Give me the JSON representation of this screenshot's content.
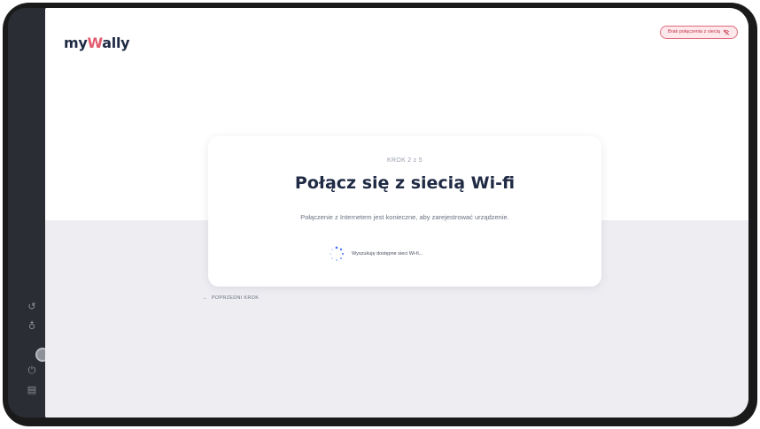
{
  "app": {
    "logo_prefix": "my",
    "logo_accent": "W",
    "logo_suffix": "ally"
  },
  "status": {
    "network_label": "Brak połączenia z siecią",
    "network_icon": "wifi-off-icon",
    "color": "#c4374e"
  },
  "wizard": {
    "step_label": "KROK 2 z 5",
    "title": "Połącz się z siecią Wi-fi",
    "subtitle": "Połączenie z Internetem jest konieczne, aby zarejestrować urządzenie.",
    "searching_label": "Wyszukuję dostępne sieci Wi-fi...",
    "back_arrow": "←",
    "back_label": "POPRZEDNI KROK"
  },
  "side_rail": {
    "icons": [
      {
        "name": "refresh-icon",
        "glyph": "↺"
      },
      {
        "name": "bulb-icon",
        "glyph": "♁"
      },
      {
        "name": "home-button-icon",
        "glyph": ""
      },
      {
        "name": "power-icon",
        "glyph": "⏻"
      },
      {
        "name": "menu-icon",
        "glyph": "▤"
      }
    ]
  },
  "colors": {
    "brand_dark": "#1f2a44",
    "brand_accent": "#e35b6f",
    "spinner": "#3b6df0"
  }
}
